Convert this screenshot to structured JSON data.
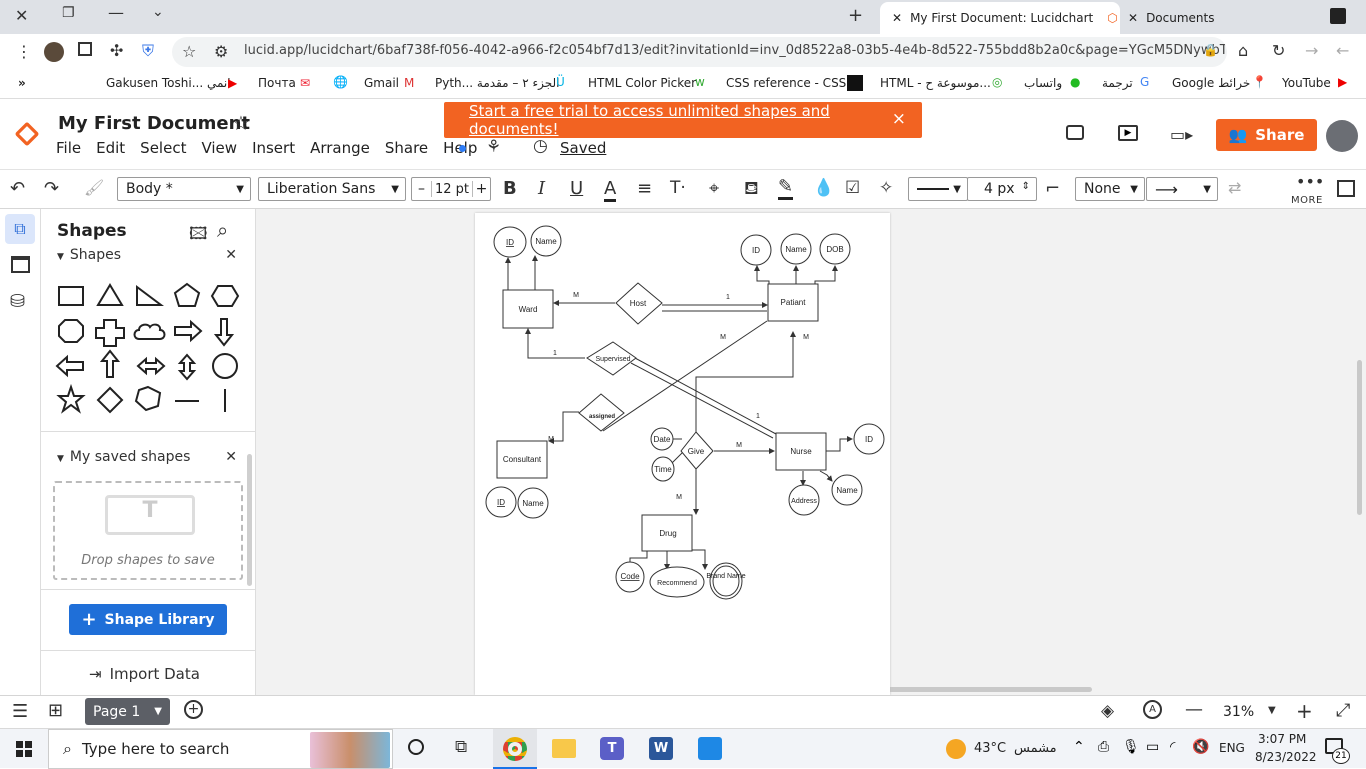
{
  "browser": {
    "tabs": [
      {
        "label": "My First Document: Lucidchart",
        "active": true
      },
      {
        "label": "Documents",
        "active": false
      }
    ],
    "url": "lucid.app/lucidchart/6baf738f-f056-4042-a966-f2c054bf7d13/edit?invitationId=inv_0d8522a8-03b5-4e4b-8d522-755bdd8b2a0c&page=YGcM5DNywbTK#",
    "bookmarks": [
      "Gakusen Toshi... انمي",
      "Почта",
      "Gmail",
      "Pyth... الجزء ٢ – مقدمة",
      "HTML Color Picker",
      "CSS reference - CSS...",
      "HTML - موسوعة ح...",
      "واتساب",
      "ترجمة",
      "Google خرائط",
      "YouTube"
    ]
  },
  "header": {
    "doc_title": "My First Document",
    "menu": [
      "File",
      "Edit",
      "Select",
      "View",
      "Insert",
      "Arrange",
      "Share",
      "Help"
    ],
    "saved": "Saved",
    "banner": "Start a free trial to access unlimited shapes and documents!",
    "banner_close": "×",
    "share": "Share"
  },
  "toolbar": {
    "style": "Body *",
    "font": "Liberation Sans",
    "font_minus": "–",
    "font_size": "12 pt",
    "font_plus": "+",
    "line_width": "4 px",
    "arrow_start": "None",
    "more": "MORE"
  },
  "panel": {
    "title": "Shapes",
    "section_shapes": "Shapes",
    "section_saved": "My saved shapes",
    "drop_text": "Drop shapes to save",
    "library_button": "Shape Library",
    "import": "Import Data"
  },
  "diagram": {
    "entities": [
      "Ward",
      "Patiant",
      "Consultant",
      "Nurse",
      "Drug"
    ],
    "relationships": [
      "Host",
      "Supervised",
      "assigned",
      "Give"
    ],
    "attributes": [
      "ID",
      "Name",
      "ID",
      "Name",
      "DOB",
      "ID",
      "Name",
      "ID",
      "Address",
      "Name",
      "Date",
      "Time",
      "Code",
      "Recommend",
      "Brand Name"
    ],
    "labels": [
      "M",
      "1",
      "M",
      "M",
      "1",
      "M",
      "1",
      "M",
      "M"
    ]
  },
  "bottom": {
    "page": "Page 1",
    "zoom": "31%"
  },
  "taskbar": {
    "search": "Type here to search",
    "weather": "43°C",
    "weather_text": "مشمس",
    "lang": "ENG",
    "time": "3:07 PM",
    "date": "8/23/2022",
    "notif": "21"
  }
}
